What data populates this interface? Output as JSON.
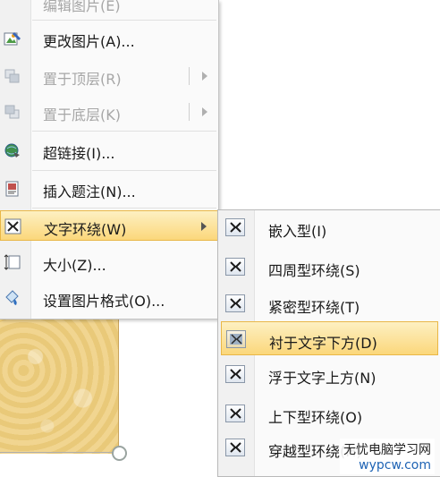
{
  "context_menu": {
    "items": [
      {
        "label": "编辑图片(E)",
        "disabled": true,
        "icon": "edit-picture-icon"
      },
      {
        "label": "更改图片(A)...",
        "disabled": false,
        "icon": "change-picture-icon"
      },
      {
        "label": "置于顶层(R)",
        "disabled": true,
        "icon": "bring-to-front-icon",
        "submenu": true
      },
      {
        "label": "置于底层(K)",
        "disabled": true,
        "icon": "send-to-back-icon",
        "submenu": true
      },
      {
        "label": "超链接(I)...",
        "disabled": false,
        "icon": "hyperlink-globe-icon"
      },
      {
        "label": "插入题注(N)...",
        "disabled": false,
        "icon": "insert-caption-icon"
      },
      {
        "label": "文字环绕(W)",
        "disabled": false,
        "icon": "text-wrap-icon",
        "submenu": true,
        "highlighted": true
      },
      {
        "label": "大小(Z)...",
        "disabled": false,
        "icon": "size-icon"
      },
      {
        "label": "设置图片格式(O)...",
        "disabled": false,
        "icon": "format-picture-icon"
      }
    ]
  },
  "wrap_submenu": {
    "items": [
      {
        "label": "嵌入型(I)",
        "icon": "inline-wrap-icon"
      },
      {
        "label": "四周型环绕(S)",
        "icon": "square-wrap-icon"
      },
      {
        "label": "紧密型环绕(T)",
        "icon": "tight-wrap-icon"
      },
      {
        "label": "衬于文字下方(D)",
        "icon": "behind-text-icon",
        "highlighted": true
      },
      {
        "label": "浮于文字上方(N)",
        "icon": "in-front-of-text-icon"
      },
      {
        "label": "上下型环绕(O)",
        "icon": "top-bottom-wrap-icon"
      },
      {
        "label": "穿越型环绕(H)",
        "icon": "through-wrap-icon"
      }
    ]
  },
  "watermark": {
    "line1": "无忧电脑学习网",
    "line2": "wypcw.com"
  },
  "colors": {
    "highlight": "#fbd77b",
    "highlight_border": "#e9b747",
    "disabled_text": "#a7a7a7",
    "image_fill": "#ecca7c"
  }
}
